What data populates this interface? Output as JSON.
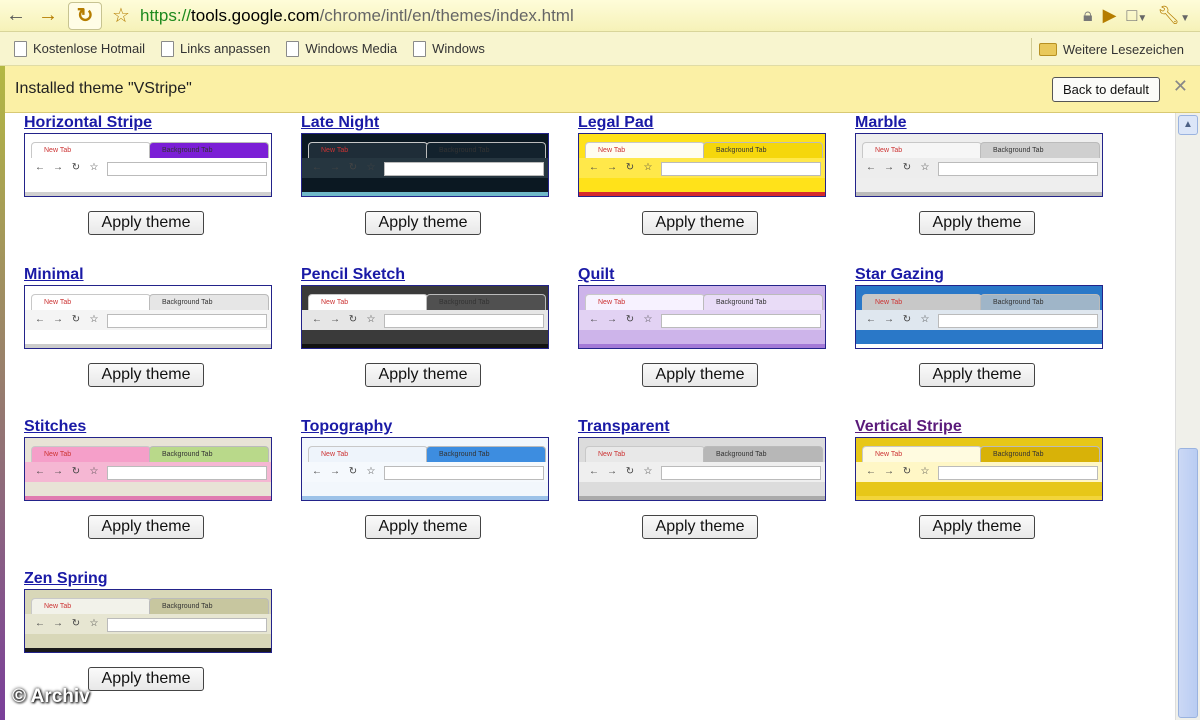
{
  "toolbar": {
    "url_scheme": "https://",
    "url_host": "tools.google.com",
    "url_path": "/chrome/intl/en/themes/index.html"
  },
  "bookmarks": {
    "items": [
      {
        "label": "Kostenlose Hotmail"
      },
      {
        "label": "Links anpassen"
      },
      {
        "label": "Windows Media"
      },
      {
        "label": "Windows"
      }
    ],
    "other_label": "Weitere Lesezeichen"
  },
  "infobar": {
    "message": "Installed theme \"VStripe\"",
    "back_button": "Back to default",
    "close": "✕"
  },
  "thumbnail_text": {
    "new_tab": "New Tab",
    "background_tab": "Background Tab"
  },
  "themes": [
    {
      "name": "Horizontal Stripe",
      "apply": "Apply theme",
      "visited": false,
      "colors": {
        "frame": "#ffffff",
        "active_tab": "#ffffff",
        "bg_tab": "#7b1fd6",
        "toolbar": "#ffffff",
        "accent": "#d0d0d0"
      }
    },
    {
      "name": "Late Night",
      "apply": "Apply theme",
      "visited": false,
      "colors": {
        "frame": "#0b1822",
        "active_tab": "#1f2d38",
        "bg_tab": "#13222d",
        "toolbar": "#263640",
        "accent": "#6fb9c9"
      }
    },
    {
      "name": "Legal Pad",
      "apply": "Apply theme",
      "visited": false,
      "colors": {
        "frame": "#ffe21a",
        "active_tab": "#fffdf0",
        "bg_tab": "#f5d70c",
        "toolbar": "#ffe84a",
        "accent": "#d62b2b"
      }
    },
    {
      "name": "Marble",
      "apply": "Apply theme",
      "visited": false,
      "colors": {
        "frame": "#eeeeee",
        "active_tab": "#f6f6f6",
        "bg_tab": "#cfcfcf",
        "toolbar": "#ededed",
        "accent": "#bbbbbb"
      }
    },
    {
      "name": "Minimal",
      "apply": "Apply theme",
      "visited": false,
      "colors": {
        "frame": "#ffffff",
        "active_tab": "#ffffff",
        "bg_tab": "#e6e6e6",
        "toolbar": "#f4f4f4",
        "accent": "#cccccc"
      }
    },
    {
      "name": "Pencil Sketch",
      "apply": "Apply theme",
      "visited": false,
      "colors": {
        "frame": "#3a3a3a",
        "active_tab": "#ffffff",
        "bg_tab": "#505050",
        "toolbar": "#e6e6e6",
        "accent": "#111111"
      }
    },
    {
      "name": "Quilt",
      "apply": "Apply theme",
      "visited": false,
      "colors": {
        "frame": "#cdb4ea",
        "active_tab": "#f7f2ff",
        "bg_tab": "#e9dcf7",
        "toolbar": "#e2d2f3",
        "accent": "#a37ad7"
      }
    },
    {
      "name": "Star Gazing",
      "apply": "Apply theme",
      "visited": false,
      "colors": {
        "frame": "#2a78c8",
        "active_tab": "#c8c8c8",
        "bg_tab": "#9fb5c8",
        "toolbar": "#dfe7ef",
        "accent": "#ffffff"
      }
    },
    {
      "name": "Stitches",
      "apply": "Apply theme",
      "visited": false,
      "colors": {
        "frame": "#e8e3d6",
        "active_tab": "#f59fc9",
        "bg_tab": "#b9d98a",
        "toolbar": "#f5b7d3",
        "accent": "#e07bb0"
      }
    },
    {
      "name": "Topography",
      "apply": "Apply theme",
      "visited": false,
      "colors": {
        "frame": "#f2f7fc",
        "active_tab": "#eef4fb",
        "bg_tab": "#3d8de0",
        "toolbar": "#f5f9fd",
        "accent": "#9cc2e8"
      }
    },
    {
      "name": "Transparent",
      "apply": "Apply theme",
      "visited": false,
      "colors": {
        "frame": "#dcdcdc",
        "active_tab": "#e8e8e8",
        "bg_tab": "#b7b7b7",
        "toolbar": "#efefef",
        "accent": "#aaaaaa"
      }
    },
    {
      "name": "Vertical Stripe",
      "apply": "Apply theme",
      "visited": true,
      "colors": {
        "frame": "#e7c718",
        "active_tab": "#fffbe0",
        "bg_tab": "#d8b208",
        "toolbar": "#fff7c6",
        "accent": "#f2d53a"
      }
    },
    {
      "name": "Zen Spring",
      "apply": "Apply theme",
      "visited": false,
      "colors": {
        "frame": "#d8d7b8",
        "active_tab": "#f2f2ea",
        "bg_tab": "#c7c69f",
        "toolbar": "#e7e6d2",
        "accent": "#1a1a1a"
      }
    }
  ],
  "watermark": "© Archiv"
}
